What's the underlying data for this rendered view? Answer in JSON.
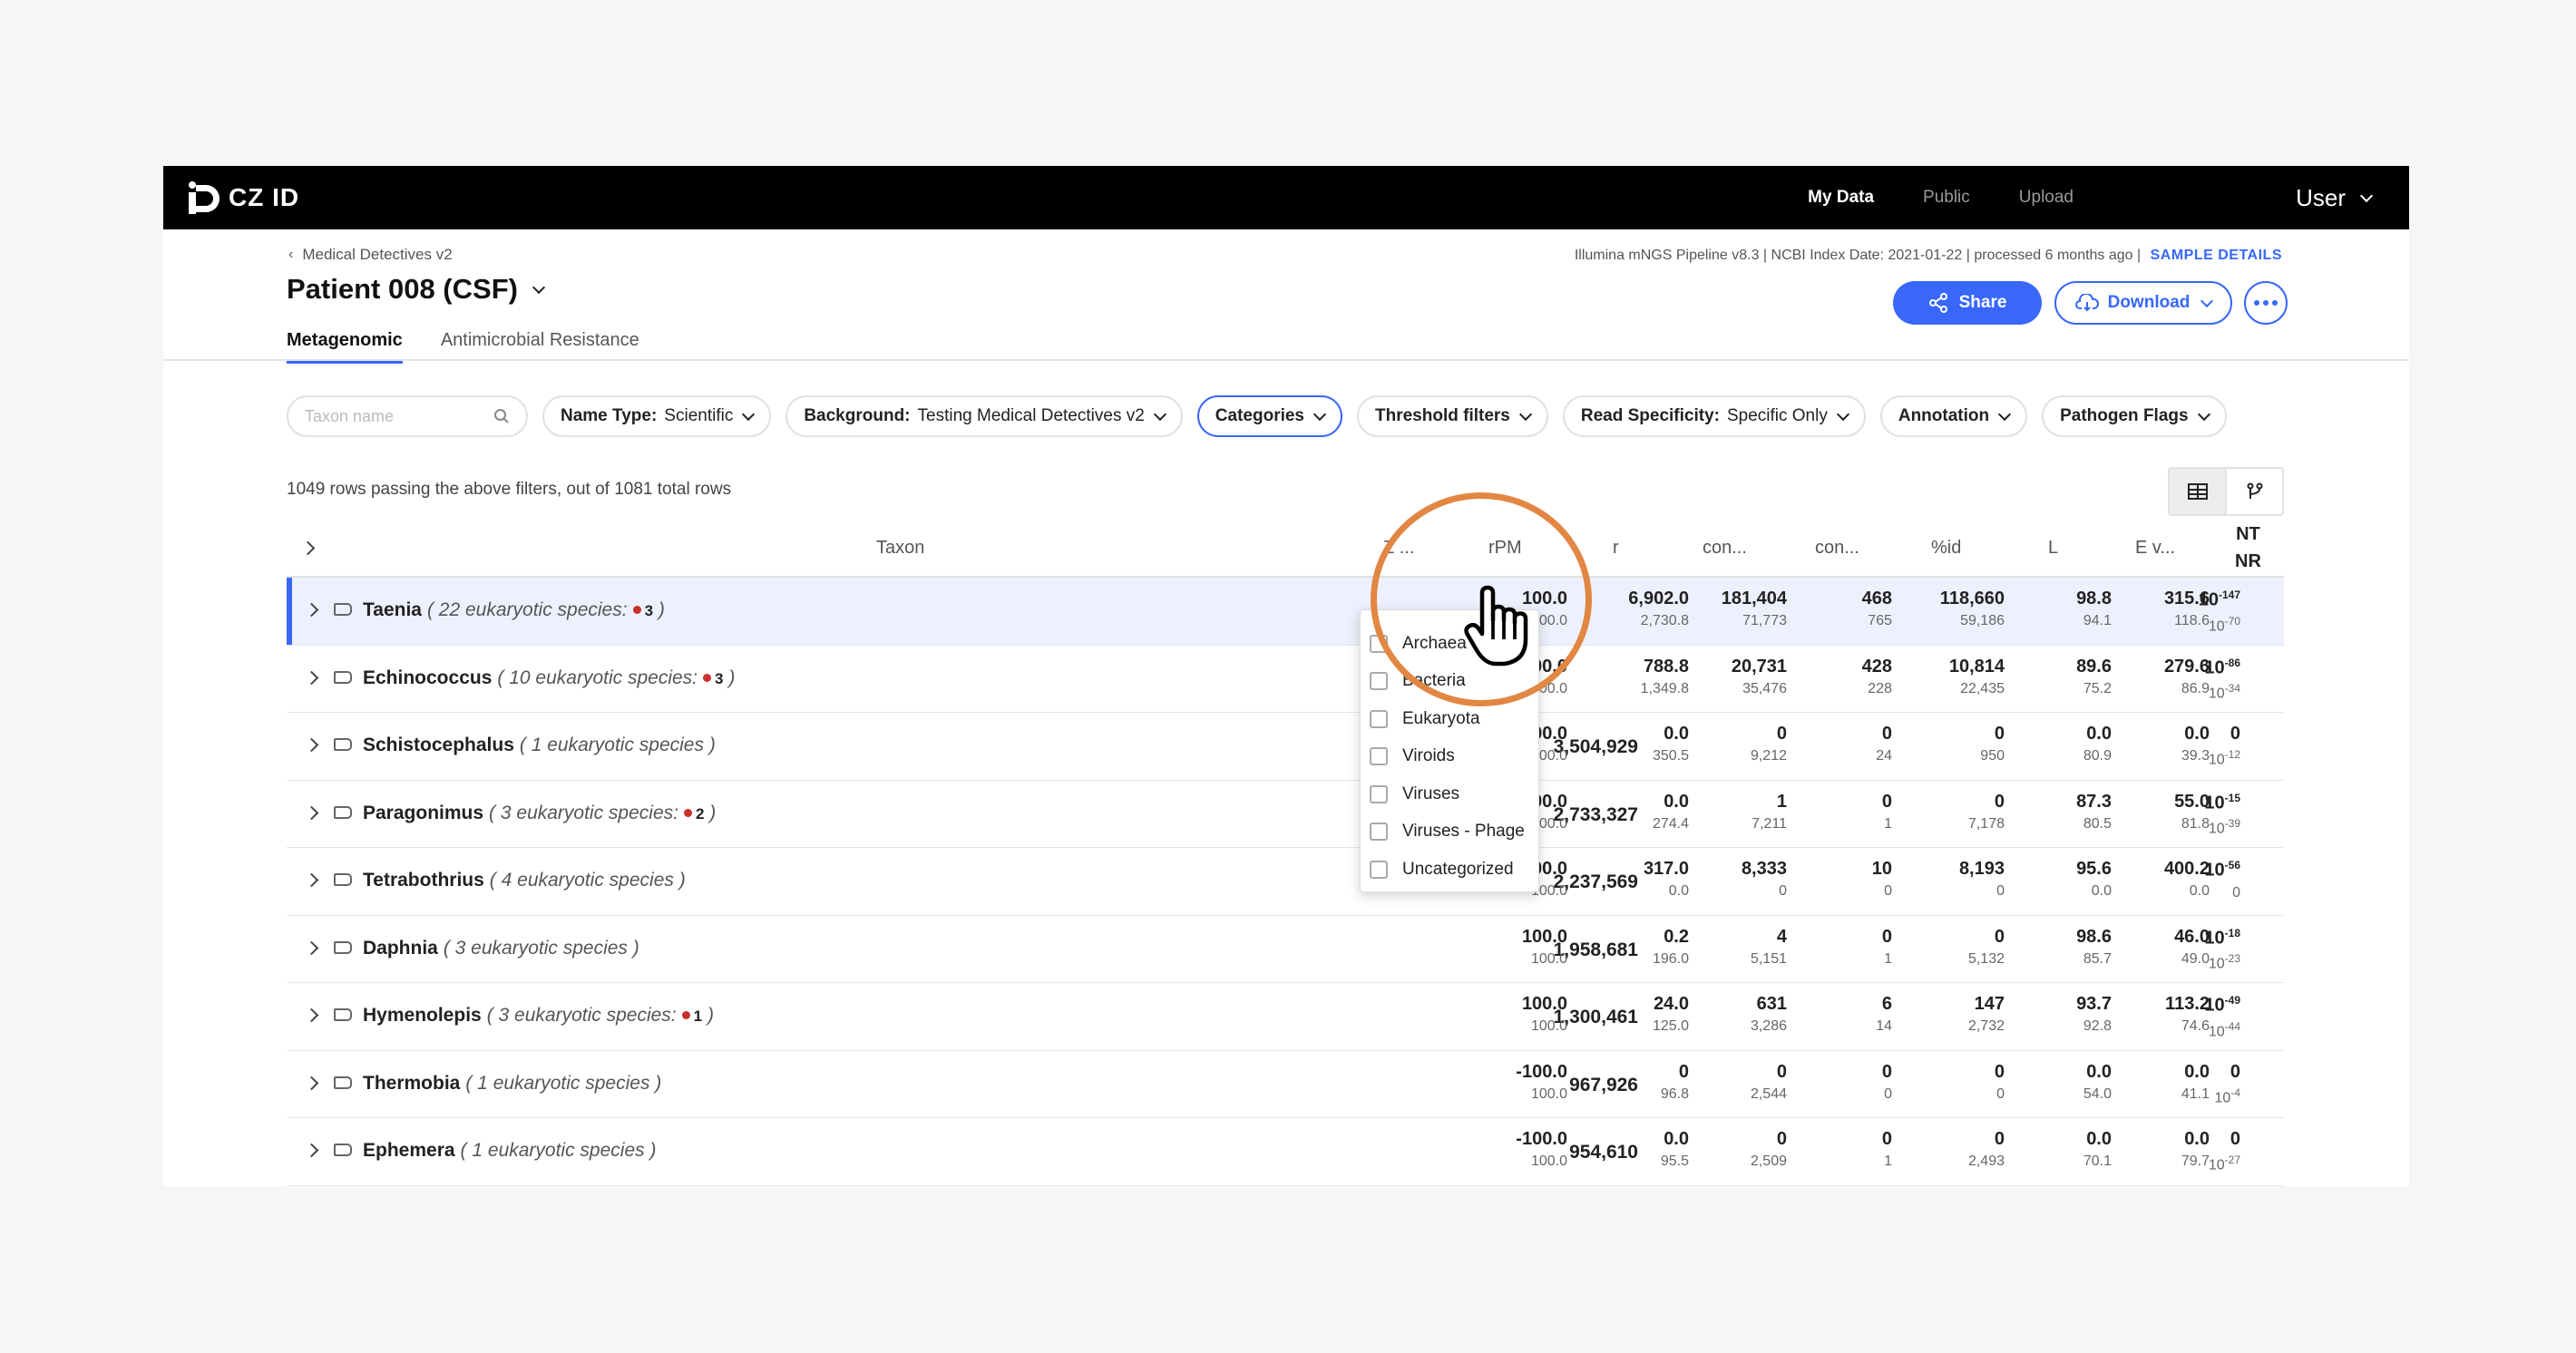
{
  "nav": {
    "logo": "CZ ID",
    "links": [
      {
        "label": "My Data",
        "active": true
      },
      {
        "label": "Public",
        "active": false
      },
      {
        "label": "Upload",
        "active": false
      }
    ],
    "user": "User"
  },
  "header": {
    "breadcrumb": "Medical Detectives v2",
    "title": "Patient 008 (CSF)",
    "pipeline_info": "Illumina mNGS Pipeline v8.3 | NCBI Index Date: 2021-01-22 | processed 6 months ago |",
    "sample_details": "SAMPLE DETAILS",
    "share_label": "Share",
    "download_label": "Download"
  },
  "tabs": [
    {
      "label": "Metagenomic",
      "active": true
    },
    {
      "label": "Antimicrobial Resistance",
      "active": false
    }
  ],
  "filters": {
    "search_placeholder": "Taxon name",
    "name_type": {
      "label": "Name Type:",
      "value": "Scientific"
    },
    "background": {
      "label": "Background:",
      "value": "Testing Medical Detectives v2"
    },
    "categories": "Categories",
    "threshold": "Threshold filters",
    "read_specificity": {
      "label": "Read Specificity:",
      "value": "Specific Only"
    },
    "annotation": "Annotation",
    "pathogen_flags": "Pathogen Flags"
  },
  "row_count": "1049 rows passing the above filters, out of 1081 total rows",
  "columns": {
    "taxon": "Taxon",
    "z": "Z ...",
    "rpm": "rPM",
    "r": "r",
    "contig": "con...",
    "contig_r": "con...",
    "pct_id": "%id",
    "l": "L",
    "e_value": "E v...",
    "nt": "NT",
    "nr": "NR"
  },
  "rows": [
    {
      "name": "Taenia",
      "desc": "( 22 eukaryotic species:",
      "flag": "3",
      "close": ")",
      "nt_total": "",
      "z": [
        "100.0",
        "100.0"
      ],
      "rpm": [
        "6,902.0",
        "2,730.8"
      ],
      "r": [
        "181,404",
        "71,773"
      ],
      "c1": [
        "468",
        "765"
      ],
      "c2": [
        "118,660",
        "59,186"
      ],
      "pid": [
        "98.8",
        "94.1"
      ],
      "l": [
        "315.6",
        "118.6"
      ],
      "e": [
        {
          "base": "10",
          "exp": "-147"
        },
        {
          "base": "10",
          "exp": "-70"
        }
      ]
    },
    {
      "name": "Echinococcus",
      "desc": "( 10 eukaryotic species:",
      "flag": "3",
      "close": ")",
      "nt_total": "",
      "z": [
        "100.0",
        "100.0"
      ],
      "rpm": [
        "788.8",
        "1,349.8"
      ],
      "r": [
        "20,731",
        "35,476"
      ],
      "c1": [
        "428",
        "228"
      ],
      "c2": [
        "10,814",
        "22,435"
      ],
      "pid": [
        "89.6",
        "75.2"
      ],
      "l": [
        "279.6",
        "86.9"
      ],
      "e": [
        {
          "base": "10",
          "exp": "-86"
        },
        {
          "base": "10",
          "exp": "-34"
        }
      ]
    },
    {
      "name": "Schistocephalus",
      "desc": "( 1 eukaryotic species )",
      "flag": "",
      "close": "",
      "nt_total": "3,504,929",
      "z": [
        "-100.0",
        "100.0"
      ],
      "rpm": [
        "0.0",
        "350.5"
      ],
      "r": [
        "0",
        "9,212"
      ],
      "c1": [
        "0",
        "24"
      ],
      "c2": [
        "0",
        "950"
      ],
      "pid": [
        "0.0",
        "80.9"
      ],
      "l": [
        "0.0",
        "39.3"
      ],
      "e": [
        {
          "base": "0",
          "exp": ""
        },
        {
          "base": "10",
          "exp": "-12"
        }
      ]
    },
    {
      "name": "Paragonimus",
      "desc": "( 3 eukaryotic species:",
      "flag": "2",
      "close": ")",
      "nt_total": "2,733,327",
      "z": [
        "100.0",
        "100.0"
      ],
      "rpm": [
        "0.0",
        "274.4"
      ],
      "r": [
        "1",
        "7,211"
      ],
      "c1": [
        "0",
        "1"
      ],
      "c2": [
        "0",
        "7,178"
      ],
      "pid": [
        "87.3",
        "80.5"
      ],
      "l": [
        "55.0",
        "81.8"
      ],
      "e": [
        {
          "base": "10",
          "exp": "-15"
        },
        {
          "base": "10",
          "exp": "-39"
        }
      ]
    },
    {
      "name": "Tetrabothrius",
      "desc": "( 4 eukaryotic species )",
      "flag": "",
      "close": "",
      "nt_total": "2,237,569",
      "z": [
        "100.0",
        "-100.0"
      ],
      "rpm": [
        "317.0",
        "0.0"
      ],
      "r": [
        "8,333",
        "0"
      ],
      "c1": [
        "10",
        "0"
      ],
      "c2": [
        "8,193",
        "0"
      ],
      "pid": [
        "95.6",
        "0.0"
      ],
      "l": [
        "400.2",
        "0.0"
      ],
      "e": [
        {
          "base": "10",
          "exp": "-56"
        },
        {
          "base": "0",
          "exp": ""
        }
      ]
    },
    {
      "name": "Daphnia",
      "desc": "( 3 eukaryotic species )",
      "flag": "",
      "close": "",
      "nt_total": "1,958,681",
      "z": [
        "100.0",
        "100.0"
      ],
      "rpm": [
        "0.2",
        "196.0"
      ],
      "r": [
        "4",
        "5,151"
      ],
      "c1": [
        "0",
        "1"
      ],
      "c2": [
        "0",
        "5,132"
      ],
      "pid": [
        "98.6",
        "85.7"
      ],
      "l": [
        "46.0",
        "49.0"
      ],
      "e": [
        {
          "base": "10",
          "exp": "-18"
        },
        {
          "base": "10",
          "exp": "-23"
        }
      ]
    },
    {
      "name": "Hymenolepis",
      "desc": "( 3 eukaryotic species:",
      "flag": "1",
      "close": ")",
      "nt_total": "1,300,461",
      "z": [
        "100.0",
        "100.0"
      ],
      "rpm": [
        "24.0",
        "125.0"
      ],
      "r": [
        "631",
        "3,286"
      ],
      "c1": [
        "6",
        "14"
      ],
      "c2": [
        "147",
        "2,732"
      ],
      "pid": [
        "93.7",
        "92.8"
      ],
      "l": [
        "113.2",
        "74.6"
      ],
      "e": [
        {
          "base": "10",
          "exp": "-49"
        },
        {
          "base": "10",
          "exp": "-44"
        }
      ]
    },
    {
      "name": "Thermobia",
      "desc": "( 1 eukaryotic species )",
      "flag": "",
      "close": "",
      "nt_total": "967,926",
      "z": [
        "-100.0",
        "100.0"
      ],
      "rpm": [
        "0",
        "96.8"
      ],
      "r": [
        "0",
        "2,544"
      ],
      "c1": [
        "0",
        "0"
      ],
      "c2": [
        "0",
        "0"
      ],
      "pid": [
        "0.0",
        "54.0"
      ],
      "l": [
        "0.0",
        "41.1"
      ],
      "e": [
        {
          "base": "0",
          "exp": ""
        },
        {
          "base": "10",
          "exp": "-4"
        }
      ]
    },
    {
      "name": "Ephemera",
      "desc": "( 1 eukaryotic species )",
      "flag": "",
      "close": "",
      "nt_total": "954,610",
      "z": [
        "-100.0",
        "100.0"
      ],
      "rpm": [
        "0.0",
        "95.5"
      ],
      "r": [
        "0",
        "2,509"
      ],
      "c1": [
        "0",
        "1"
      ],
      "c2": [
        "0",
        "2,493"
      ],
      "pid": [
        "0.0",
        "70.1"
      ],
      "l": [
        "0.0",
        "79.7"
      ],
      "e": [
        {
          "base": "0",
          "exp": ""
        },
        {
          "base": "10",
          "exp": "-27"
        }
      ]
    }
  ],
  "categories_dropdown": [
    "Archaea",
    "Bacteria",
    "Eukaryota",
    "Viroids",
    "Viruses",
    "Viruses - Phage",
    "Uncategorized"
  ],
  "colors": {
    "accent": "#3867fa",
    "highlight": "#e28743",
    "flag": "#c9302c"
  }
}
